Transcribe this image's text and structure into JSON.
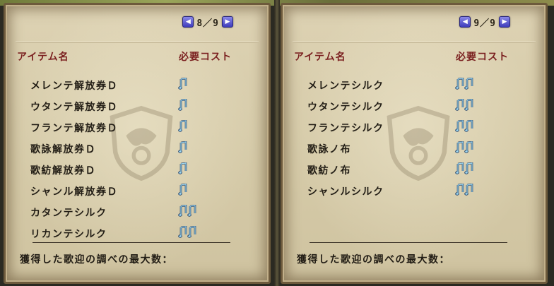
{
  "panels": [
    {
      "page": "8／9",
      "header_name": "アイテム名",
      "header_cost": "必要コスト",
      "items": [
        {
          "name": "メレンテ解放券Ｄ",
          "cost": 1
        },
        {
          "name": "ウタンテ解放券Ｄ",
          "cost": 1
        },
        {
          "name": "フランテ解放券Ｄ",
          "cost": 1
        },
        {
          "name": "歌詠解放券Ｄ",
          "cost": 1
        },
        {
          "name": "歌紡解放券Ｄ",
          "cost": 1
        },
        {
          "name": "シャンル解放券Ｄ",
          "cost": 1
        },
        {
          "name": "カタンテシルク",
          "cost": 2
        },
        {
          "name": "リカンテシルク",
          "cost": 2
        }
      ],
      "footer": "獲得した歌迎の調べの最大数："
    },
    {
      "page": "9／9",
      "header_name": "アイテム名",
      "header_cost": "必要コスト",
      "items": [
        {
          "name": "メレンテシルク",
          "cost": 2
        },
        {
          "name": "ウタンテシルク",
          "cost": 2
        },
        {
          "name": "フランテシルク",
          "cost": 2
        },
        {
          "name": "歌詠ノ布",
          "cost": 2
        },
        {
          "name": "歌紡ノ布",
          "cost": 2
        },
        {
          "name": "シャンルシルク",
          "cost": 2
        }
      ],
      "footer": "獲得した歌迎の調べの最大数："
    }
  ],
  "icons": {
    "prev": "triangle-left-icon",
    "next": "triangle-right-icon",
    "cost": "music-note-icon",
    "watermark": "guild-emblem-icon"
  }
}
